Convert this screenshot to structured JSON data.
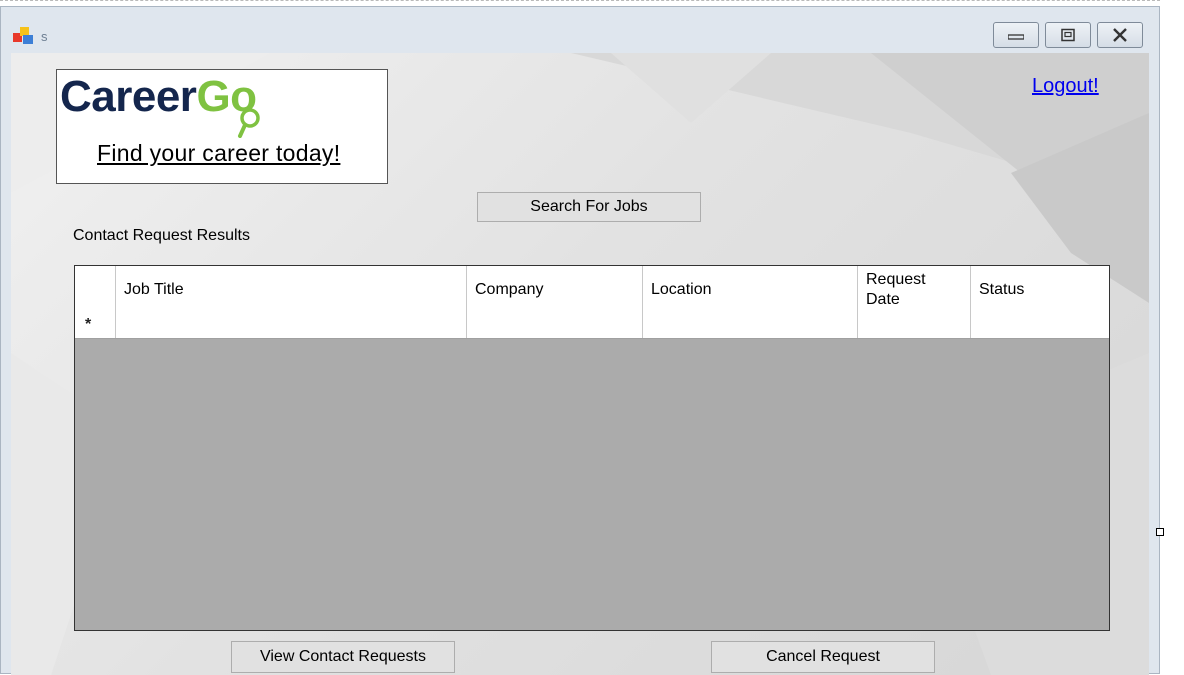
{
  "window": {
    "title": "s"
  },
  "logo": {
    "brand_part1": "Career",
    "brand_part2": "Go",
    "tagline": "Find your career today!"
  },
  "header": {
    "logout_label": "Logout!"
  },
  "actions": {
    "search_jobs_label": "Search For Jobs",
    "view_requests_label": "View Contact Requests",
    "cancel_request_label": "Cancel Request"
  },
  "results": {
    "title": "Contact Request Results",
    "columns": [
      "Job Title",
      "Company",
      "Location",
      "Request\nDate",
      "Status"
    ],
    "new_row_marker": "*"
  }
}
